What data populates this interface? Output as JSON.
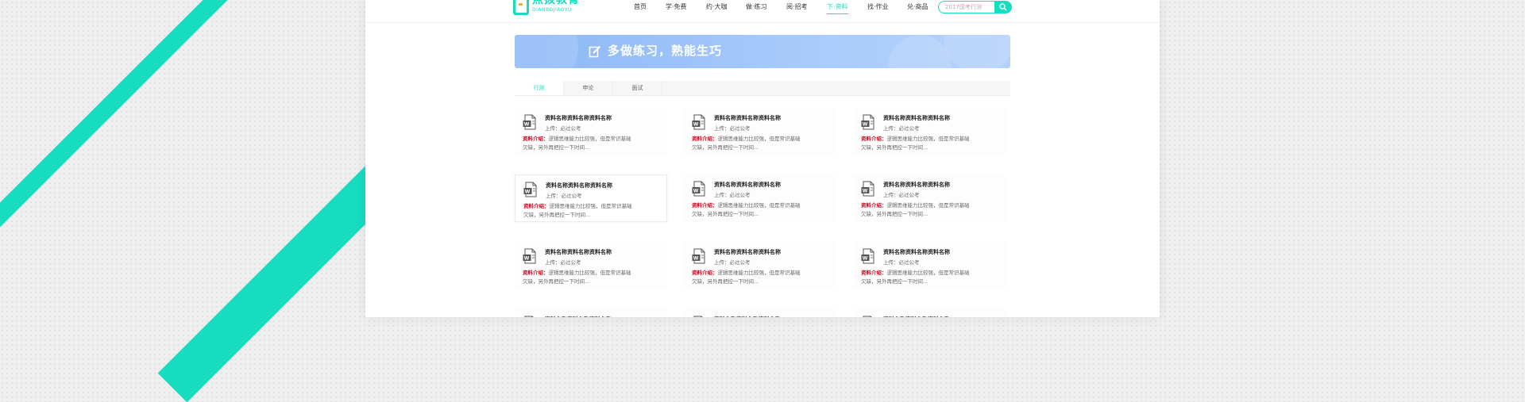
{
  "brand": {
    "name_cn": "点拨教育",
    "name_en": "DIANBOJIAOYU"
  },
  "nav": {
    "items": [
      {
        "label": "首页",
        "active": false
      },
      {
        "label": "学·免费",
        "active": false
      },
      {
        "label": "约·大咖",
        "active": false
      },
      {
        "label": "做·练习",
        "active": false
      },
      {
        "label": "阅·招考",
        "active": false
      },
      {
        "label": "下·资料",
        "active": true
      },
      {
        "label": "找·作业",
        "active": false
      },
      {
        "label": "兑·商品",
        "active": false
      }
    ]
  },
  "search": {
    "placeholder": "2017国考行测",
    "button_icon": "search-icon"
  },
  "banner": {
    "title": "多做练习，熟能生巧",
    "icon": "edit-icon"
  },
  "tabs": [
    {
      "label": "行测",
      "active": true
    },
    {
      "label": "申论",
      "active": false
    },
    {
      "label": "面试",
      "active": false
    }
  ],
  "cards": [
    {
      "title": "资料名称资料名称资料名称",
      "upload": "上传：必过公考",
      "desc_label": "资料介绍：",
      "desc_line1": "逻辑思维能力比较强，但是常识基础",
      "desc_line2": "欠缺，另外再把控一下时间...",
      "icon": "word-doc-icon"
    },
    {
      "title": "资料名称资料名称资料名称",
      "upload": "上传：必过公考",
      "desc_label": "资料介绍：",
      "desc_line1": "逻辑思维能力比较强，但是常识基础",
      "desc_line2": "欠缺，另外再把控一下时间...",
      "icon": "word-doc-icon"
    },
    {
      "title": "资料名称资料名称资料名称",
      "upload": "上传：必过公考",
      "desc_label": "资料介绍：",
      "desc_line1": "逻辑思维能力比较强，但是常识基础",
      "desc_line2": "欠缺，另外再把控一下时间...",
      "icon": "word-doc-icon"
    },
    {
      "title": "资料名称资料名称资料名称",
      "upload": "上传：必过公考",
      "desc_label": "资料介绍：",
      "desc_line1": "逻辑思维能力比较强，但是常识基础",
      "desc_line2": "欠缺，另外再把控一下时间...",
      "icon": "word-doc-icon"
    },
    {
      "title": "资料名称资料名称资料名称",
      "upload": "上传：必过公考",
      "desc_label": "资料介绍：",
      "desc_line1": "逻辑思维能力比较强，但是常识基础",
      "desc_line2": "欠缺，另外再把控一下时间...",
      "icon": "word-doc-icon"
    },
    {
      "title": "资料名称资料名称资料名称",
      "upload": "上传：必过公考",
      "desc_label": "资料介绍：",
      "desc_line1": "逻辑思维能力比较强，但是常识基础",
      "desc_line2": "欠缺，另外再把控一下时间...",
      "icon": "word-doc-icon"
    },
    {
      "title": "资料名称资料名称资料名称",
      "upload": "上传：必过公考",
      "desc_label": "资料介绍：",
      "desc_line1": "逻辑思维能力比较强，但是常识基础",
      "desc_line2": "欠缺，另外再把控一下时间...",
      "icon": "word-doc-icon"
    },
    {
      "title": "资料名称资料名称资料名称",
      "upload": "上传：必过公考",
      "desc_label": "资料介绍：",
      "desc_line1": "逻辑思维能力比较强，但是常识基础",
      "desc_line2": "欠缺，另外再把控一下时间...",
      "icon": "word-doc-icon"
    },
    {
      "title": "资料名称资料名称资料名称",
      "upload": "上传：必过公考",
      "desc_label": "资料介绍：",
      "desc_line1": "逻辑思维能力比较强，但是常识基础",
      "desc_line2": "欠缺，另外再把控一下时间...",
      "icon": "word-doc-icon"
    },
    {
      "title": "资料名称资料名称资料名称",
      "upload": "",
      "desc_label": "",
      "desc_line1": "",
      "desc_line2": "",
      "icon": "word-doc-icon"
    },
    {
      "title": "资料名称资料名称资料名称",
      "upload": "",
      "desc_label": "",
      "desc_line1": "",
      "desc_line2": "",
      "icon": "word-doc-icon"
    },
    {
      "title": "资料名称资料名称资料名称",
      "upload": "",
      "desc_label": "",
      "desc_line1": "",
      "desc_line2": "",
      "icon": "word-doc-icon"
    }
  ],
  "colors": {
    "accent": "#16dcc0",
    "banner": "#8cb8f6",
    "desc_label": "#d0021b"
  }
}
